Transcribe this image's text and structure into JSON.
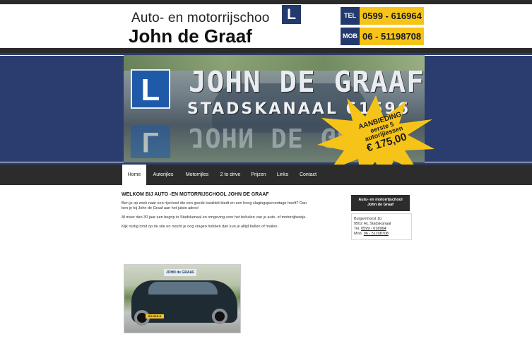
{
  "header": {
    "logo_line1": "Auto- en motorrijschoo",
    "logo_L": "L",
    "logo_line2": "John de Graaf",
    "tel_tag": "TEL",
    "tel_number": "0599 - 616964",
    "mob_tag": "MOB",
    "mob_number": "06 - 51198708"
  },
  "banner": {
    "sign_L": "L",
    "sign_text": "JOHN DE GRAAF",
    "sign_sub": "STADSKANAAL  61696",
    "offer_line1": "AANBIEDING",
    "offer_line2": "eerste 5",
    "offer_line3": "autorijlessen",
    "offer_price": "€ 175,00"
  },
  "nav": {
    "items": [
      {
        "label": "Home",
        "active": true
      },
      {
        "label": "Autorijles"
      },
      {
        "label": "Motorrijles"
      },
      {
        "label": "2 to drive"
      },
      {
        "label": "Prijzen"
      },
      {
        "label": "Links"
      },
      {
        "label": "Contact"
      }
    ]
  },
  "main": {
    "welcome": "WELKOM BIJ AUTO -EN MOTORRIJSCHOOL JOHN DE GRAAF",
    "p1": "Ben je op zoek naar een rijschool die een goede kwaliteit biedt en een hoog slagingspercentage heeft? Dan ben je bij John de Graaf aan het juiste adres!",
    "p2": "Al meer dan 30 jaar een begrip in Stadskanaal en omgeving voor het behalen van je auto- of motorrijbewijs.",
    "p3": "Kijk rustig rond op de site en mocht je nog vragen hebben dan kun je altijd bellen of mailen.",
    "photo_sign": "JOHN de GRAAF",
    "photo_plate": "XX-XXX-X"
  },
  "sidebar": {
    "title_line1": "Auto- en motorrijschool",
    "title_line2": "John de Graaf",
    "address": "Burgemhorst 1b",
    "city": "9502 HL Stadskanaal",
    "tel_label": "Tel.",
    "tel": "0599 - 616964",
    "mob_label": "Mob.",
    "mob": "06 - 51198708"
  },
  "colors": {
    "navy": "#243a6e",
    "accent_yellow": "#f6c418",
    "dark_bar": "#2c2c2c",
    "banner_blue": "#2a3d6e"
  }
}
